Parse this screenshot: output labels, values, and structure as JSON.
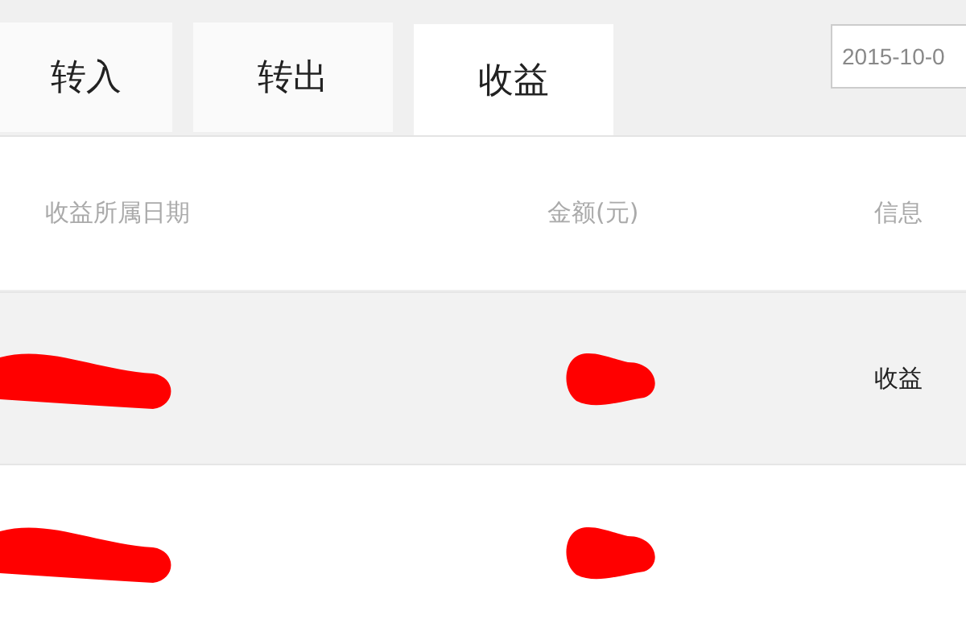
{
  "tabs": [
    {
      "label": "转入",
      "selected": false
    },
    {
      "label": "转出",
      "selected": false
    },
    {
      "label": "收益",
      "selected": true
    }
  ],
  "date_field": {
    "value": "2015-10-0"
  },
  "table": {
    "columns": [
      "收益所属日期",
      "金额(元)",
      "信息"
    ],
    "rows": [
      {
        "selected": true,
        "info": "收益"
      },
      {
        "selected": false
      }
    ]
  }
}
